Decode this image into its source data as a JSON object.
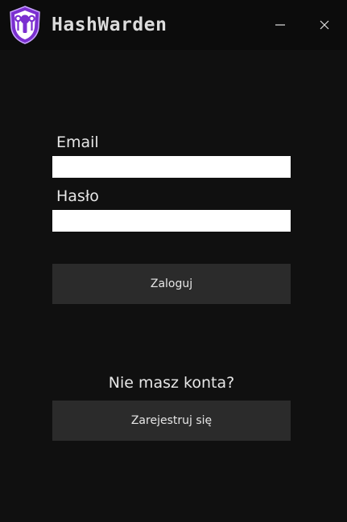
{
  "window": {
    "title": "HashWarden",
    "logo_icon": "shield-keyhole-icon",
    "minimize_icon": "minimize-icon",
    "close_icon": "close-icon",
    "accent_color": "#7b2fd0"
  },
  "login_form": {
    "email_label": "Email",
    "email_value": "",
    "password_label": "Hasło",
    "password_value": "",
    "login_button": "Zaloguj"
  },
  "register": {
    "prompt": "Nie masz konta?",
    "register_button": "Zarejestruj się"
  }
}
